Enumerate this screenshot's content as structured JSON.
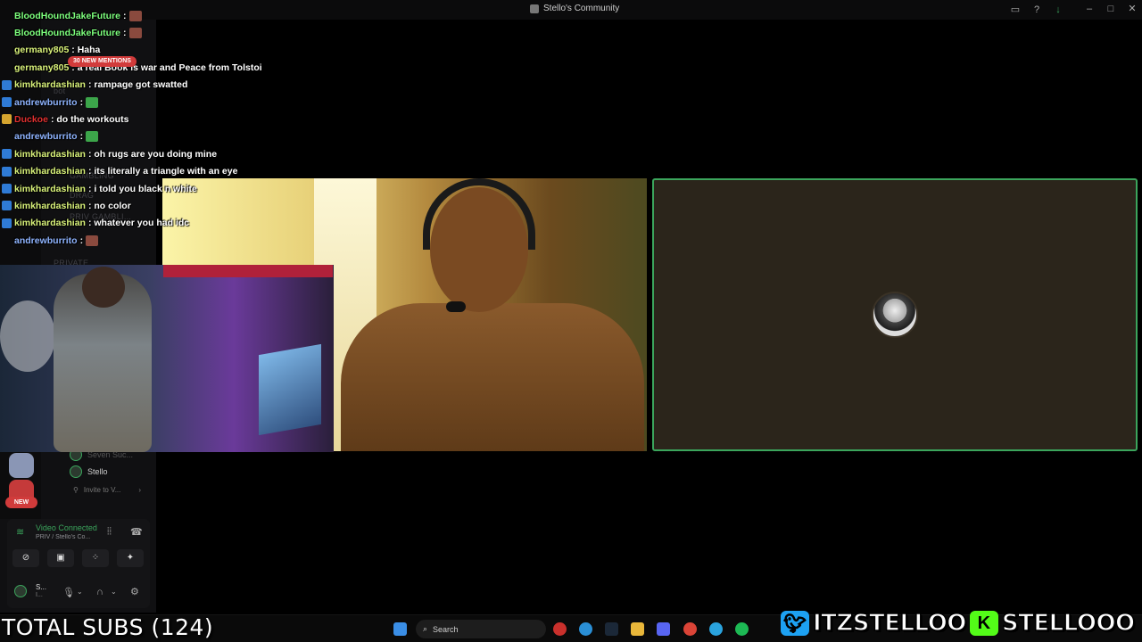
{
  "window": {
    "title": "Stello's Community"
  },
  "sidebar": {
    "channels": [
      "bot",
      "GAMBLING",
      "DRAG",
      "PRIV GAMBLI...",
      "PRIVATE"
    ],
    "voice_members": [
      {
        "name": "Seven Suc..."
      },
      {
        "name": "Stello"
      }
    ],
    "invite_label": "Invite to V...",
    "new_badge": "NEW"
  },
  "chat": {
    "mentions_pill": "30 NEW MENTIONS",
    "messages": [
      {
        "user": "BloodHoundJakeFuture",
        "color": "#7dff7d",
        "badge": "none",
        "text": ":",
        "emote": "red"
      },
      {
        "user": "BloodHoundJakeFuture",
        "color": "#7dff7d",
        "badge": "none",
        "text": ":",
        "emote": "red"
      },
      {
        "user": "germany805",
        "color": "#d9f27a",
        "badge": "none",
        "text": ": Haha",
        "emote": ""
      },
      {
        "user": "germany805",
        "color": "#d9f27a",
        "badge": "none",
        "text": ": a real Book is war and Peace from Tolstoi",
        "emote": ""
      },
      {
        "user": "kimkhardashian",
        "color": "#d9f27a",
        "badge": "blue",
        "text": ": rampage got swatted",
        "emote": ""
      },
      {
        "user": "andrewburrito",
        "color": "#8fb4ff",
        "badge": "blue",
        "text": ":",
        "emote": "green"
      },
      {
        "user": "Duckoe",
        "color": "#e03030",
        "badge": "gold",
        "text": ": do the workouts",
        "emote": ""
      },
      {
        "user": "andrewburrito",
        "color": "#8fb4ff",
        "badge": "none",
        "text": ":",
        "emote": "green"
      },
      {
        "user": "kimkhardashian",
        "color": "#d9f27a",
        "badge": "blue",
        "text": ": oh rugs are you doing mine",
        "emote": ""
      },
      {
        "user": "kimkhardashian",
        "color": "#d9f27a",
        "badge": "blue",
        "text": ": its literally a triangle with an eye",
        "emote": ""
      },
      {
        "user": "kimkhardashian",
        "color": "#d9f27a",
        "badge": "blue",
        "text": ": i told you black n white",
        "emote": ""
      },
      {
        "user": "kimkhardashian",
        "color": "#d9f27a",
        "badge": "blue",
        "text": ": no color",
        "emote": ""
      },
      {
        "user": "kimkhardashian",
        "color": "#d9f27a",
        "badge": "blue",
        "text": ": whatever you had idc",
        "emote": ""
      },
      {
        "user": "andrewburrito",
        "color": "#8fb4ff",
        "badge": "none",
        "text": ":",
        "emote": "red"
      }
    ]
  },
  "voice_panel": {
    "status": "Video Connected",
    "channel": "PRIV / Stello's Co...",
    "user_initial": "S...",
    "user_sub": "I..."
  },
  "taskbar": {
    "search_placeholder": "Search"
  },
  "overlay": {
    "total_subs": "TOTAL SUBS (124)",
    "twitter_handle": "ITZSTELLOO",
    "kick_handle": "STELLOOO",
    "kick_letter": "K"
  },
  "colors": {
    "accent_green": "#3ba55c",
    "mention_red": "#d13b3b",
    "twitter_blue": "#1da1f2",
    "kick_green": "#53fc18"
  }
}
